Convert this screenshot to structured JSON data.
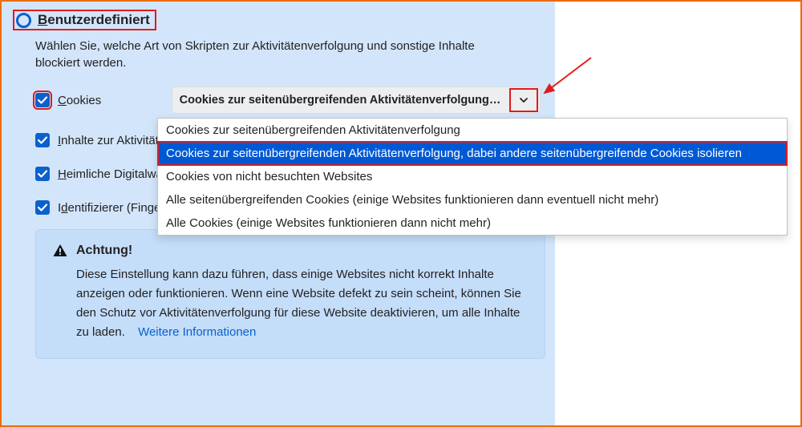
{
  "section": {
    "title_html": "<span>B</span>enutzerdefiniert",
    "description": "Wählen Sie, welche Art von Skripten zur Aktivitätenverfolgung und sonstige Inhalte blockiert werden."
  },
  "options": {
    "cookies": {
      "label_html": "<span class=\"u\">C</span>ookies",
      "checked": true
    },
    "tracking_content": {
      "label_html": "<span class=\"u\">I</span>nhalte zur Aktivitätenverfolgung",
      "checked": true
    },
    "cryptominers": {
      "label_html": "<span class=\"u\">H</span>eimliche Digitalwährungsberechner (Krypto-Miner)",
      "checked": true
    },
    "fingerprinters": {
      "label_html": "I<span class=\"u\">d</span>entifizierer (Fingerprinter)",
      "checked": true
    }
  },
  "cookies_select": {
    "selected": "Cookies zur seitenübergreifenden Aktivitätenverfolgung…",
    "items": [
      "Cookies zur seitenübergreifenden Aktivitätenverfolgung",
      "Cookies zur seitenübergreifenden Aktivitätenverfolgung, dabei andere seitenübergreifende Cookies isolieren",
      "Cookies von nicht besuchten Websites",
      "Alle seitenübergreifenden Cookies (einige Websites funktionieren dann eventuell nicht mehr)",
      "Alle Cookies (einige Websites funktionieren dann nicht mehr)"
    ],
    "selected_index": 1
  },
  "warning": {
    "title": "Achtung!",
    "body": "Diese Einstellung kann dazu führen, dass einige Websites nicht korrekt Inhalte anzeigen oder funktionieren. Wenn eine Website defekt zu sein scheint, können Sie den Schutz vor Aktivitätenverfolgung für diese Website deaktivieren, um alle Inhalte zu laden.",
    "link": "Weitere Informationen"
  },
  "colors": {
    "accent": "#0a61cd",
    "highlight_border": "#e11b1b",
    "panel_bg": "#d3e5fb",
    "frame_border": "#ec6b0c"
  }
}
